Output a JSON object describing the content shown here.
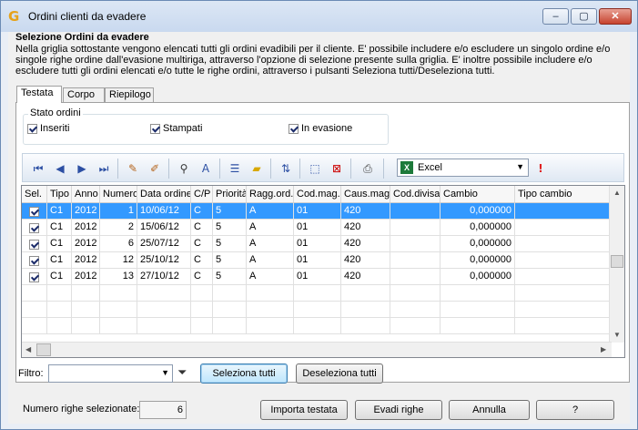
{
  "window": {
    "title": "Ordini clienti da evadere",
    "controls": {
      "minimize": "–",
      "maximize": "▢",
      "close": "✕"
    }
  },
  "header": {
    "title": "Selezione Ordini da evadere",
    "description": "Nella griglia sottostante vengono elencati tutti gli ordini evadibili per il cliente. E' possibile includere e/o escludere un singolo ordine e/o singole righe ordine dall'evasione multiriga, attraverso l'opzione di selezione presente sulla griglia. E' inoltre possibile includere e/o escludere tutti gli ordini elencati e/o tutte le righe ordini, attraverso i pulsanti Seleziona tutti/Deseleziona tutti."
  },
  "tabs": [
    "Testata",
    "Corpo",
    "Riepilogo"
  ],
  "stato_ordini": {
    "legend": "Stato ordini",
    "options": [
      {
        "label": "Inseriti",
        "checked": true
      },
      {
        "label": "Stampati",
        "checked": true
      },
      {
        "label": "In evasione",
        "checked": true
      }
    ]
  },
  "toolbar": {
    "export_format": "Excel",
    "icons": [
      "first-icon",
      "prev-icon",
      "next-icon",
      "last-icon",
      "edit-icon",
      "edit-all-icon",
      "find-icon",
      "find-next-icon",
      "list-icon",
      "note-icon",
      "sort-icon",
      "select-area-icon",
      "deselect-area-icon",
      "print-icon",
      "excel-icon",
      "alert-icon"
    ],
    "colors": {
      "accent": "#2c4fa3",
      "excel": "#1d7a3a",
      "alert": "#e02020"
    }
  },
  "grid": {
    "columns": [
      "Sel.",
      "Tipo",
      "Anno",
      "Numero",
      "Data ordine",
      "C/P",
      "Priorità",
      "Ragg.ord.",
      "Cod.mag.",
      "Caus.mag.",
      "Cod.divisa",
      "Cambio",
      "Tipo cambio"
    ],
    "rows": [
      {
        "sel": true,
        "tipo": "C1",
        "anno": "2012",
        "numero": "1",
        "data": "10/06/12",
        "cp": "C",
        "priorita": "5",
        "ragg": "A",
        "codmag": "01",
        "causmag": "420",
        "coddivisa": "",
        "cambio": "0,000000",
        "tipocambio": "",
        "selected": true
      },
      {
        "sel": true,
        "tipo": "C1",
        "anno": "2012",
        "numero": "2",
        "data": "15/06/12",
        "cp": "C",
        "priorita": "5",
        "ragg": "A",
        "codmag": "01",
        "causmag": "420",
        "coddivisa": "",
        "cambio": "0,000000",
        "tipocambio": "",
        "selected": false
      },
      {
        "sel": true,
        "tipo": "C1",
        "anno": "2012",
        "numero": "6",
        "data": "25/07/12",
        "cp": "C",
        "priorita": "5",
        "ragg": "A",
        "codmag": "01",
        "causmag": "420",
        "coddivisa": "",
        "cambio": "0,000000",
        "tipocambio": "",
        "selected": false
      },
      {
        "sel": true,
        "tipo": "C1",
        "anno": "2012",
        "numero": "12",
        "data": "25/10/12",
        "cp": "C",
        "priorita": "5",
        "ragg": "A",
        "codmag": "01",
        "causmag": "420",
        "coddivisa": "",
        "cambio": "0,000000",
        "tipocambio": "",
        "selected": false
      },
      {
        "sel": true,
        "tipo": "C1",
        "anno": "2012",
        "numero": "13",
        "data": "27/10/12",
        "cp": "C",
        "priorita": "5",
        "ragg": "A",
        "codmag": "01",
        "causmag": "420",
        "coddivisa": "",
        "cambio": "0,000000",
        "tipocambio": "",
        "selected": false
      }
    ],
    "selection_color": "#3399ff"
  },
  "filter": {
    "label": "Filtro:",
    "value": ""
  },
  "buttons": {
    "select_all": "Seleziona tutti",
    "deselect_all": "Deseleziona tutti",
    "import_header": "Importa testata",
    "fulfill_rows": "Evadi righe",
    "cancel": "Annulla",
    "help": "?"
  },
  "footer": {
    "selected_rows_label": "Numero righe selezionate:",
    "selected_rows_value": "6"
  }
}
